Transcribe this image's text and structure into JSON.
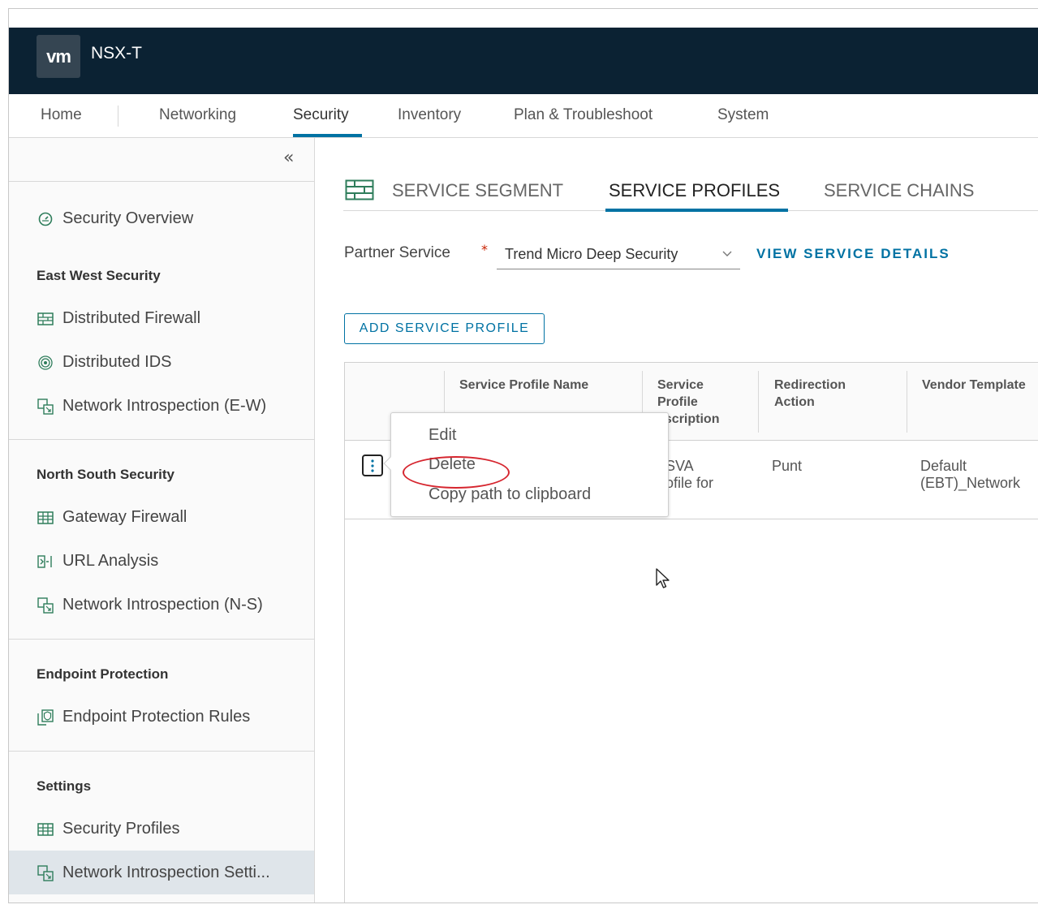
{
  "header": {
    "logo": "vm",
    "app_title": "NSX-T"
  },
  "nav": {
    "items": [
      {
        "label": "Home"
      },
      {
        "label": "Networking"
      },
      {
        "label": "Security"
      },
      {
        "label": "Inventory"
      },
      {
        "label": "Plan & Troubleshoot"
      },
      {
        "label": "System"
      }
    ],
    "active": "Security"
  },
  "sidebar": {
    "collapse_glyph": "«",
    "overview": {
      "label": "Security Overview",
      "icon": "gauge-icon"
    },
    "sections": [
      {
        "heading": "East West Security",
        "items": [
          {
            "label": "Distributed Firewall",
            "icon": "firewall-icon"
          },
          {
            "label": "Distributed IDS",
            "icon": "target-icon"
          },
          {
            "label": "Network Introspection (E-W)",
            "icon": "introspection-icon"
          }
        ]
      },
      {
        "heading": "North South Security",
        "items": [
          {
            "label": "Gateway Firewall",
            "icon": "gateway-firewall-icon"
          },
          {
            "label": "URL Analysis",
            "icon": "url-analysis-icon"
          },
          {
            "label": "Network Introspection (N-S)",
            "icon": "introspection-icon"
          }
        ]
      },
      {
        "heading": "Endpoint Protection",
        "items": [
          {
            "label": "Endpoint Protection Rules",
            "icon": "endpoint-protection-icon"
          }
        ]
      },
      {
        "heading": "Settings",
        "items": [
          {
            "label": "Security Profiles",
            "icon": "gateway-firewall-icon"
          },
          {
            "label": "Network Introspection Setti...",
            "icon": "introspection-icon",
            "active": true
          }
        ]
      }
    ]
  },
  "tabs": {
    "items": [
      {
        "label": "SERVICE SEGMENT"
      },
      {
        "label": "SERVICE PROFILES"
      },
      {
        "label": "SERVICE CHAINS"
      }
    ],
    "active": "SERVICE PROFILES"
  },
  "form": {
    "partner_label": "Partner Service",
    "required_marker": "*",
    "partner_value": "Trend Micro Deep Security",
    "view_details": "VIEW SERVICE DETAILS",
    "add_button": "ADD SERVICE PROFILE"
  },
  "table": {
    "columns": [
      {
        "line1": "Service Profile Name",
        "line2": "",
        "line3": ""
      },
      {
        "line1": "Service",
        "line2": "Profile",
        "line3": "escription"
      },
      {
        "line1": "Redirection",
        "line2": "Action",
        "line3": ""
      },
      {
        "line1": "Vendor Template",
        "line2": "",
        "line3": ""
      }
    ],
    "rows": [
      {
        "description_line1": "SVA",
        "description_line2": "ofile for",
        "redirection_action": "Punt",
        "vendor_line1": "Default",
        "vendor_line2": "(EBT)_Network"
      }
    ]
  },
  "context_menu": {
    "items": [
      {
        "label": "Edit"
      },
      {
        "label": "Delete"
      },
      {
        "label": "Copy path to clipboard"
      }
    ],
    "highlighted": "Delete",
    "highlight_color": "#d6262f"
  },
  "colors": {
    "header_bg": "#0b2233",
    "accent": "#0072a3",
    "sidebar_active_bg": "#dfe5ea"
  }
}
